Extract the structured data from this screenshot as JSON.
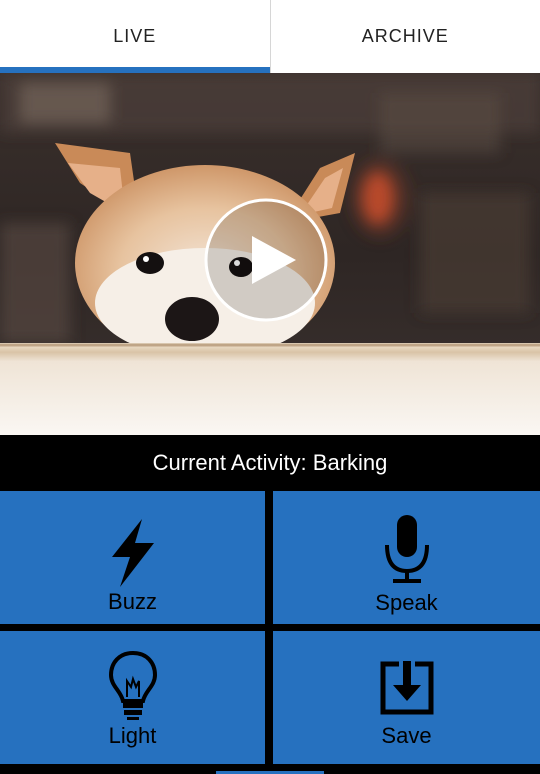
{
  "tabs": {
    "live": "LIVE",
    "archive": "ARCHIVE",
    "active": "live"
  },
  "video": {
    "play_icon": "play-icon",
    "subject": "shiba-puppy-photo"
  },
  "status": {
    "activity_text": "Current Activity: Barking"
  },
  "actions": {
    "buzz": {
      "label": "Buzz",
      "icon": "lightning-icon"
    },
    "speak": {
      "label": "Speak",
      "icon": "microphone-icon"
    },
    "light": {
      "label": "Light",
      "icon": "lightbulb-icon"
    },
    "save": {
      "label": "Save",
      "icon": "save-download-icon"
    }
  },
  "colors": {
    "accent": "#2671bf",
    "background": "#000000",
    "tab_background": "#ffffff"
  }
}
